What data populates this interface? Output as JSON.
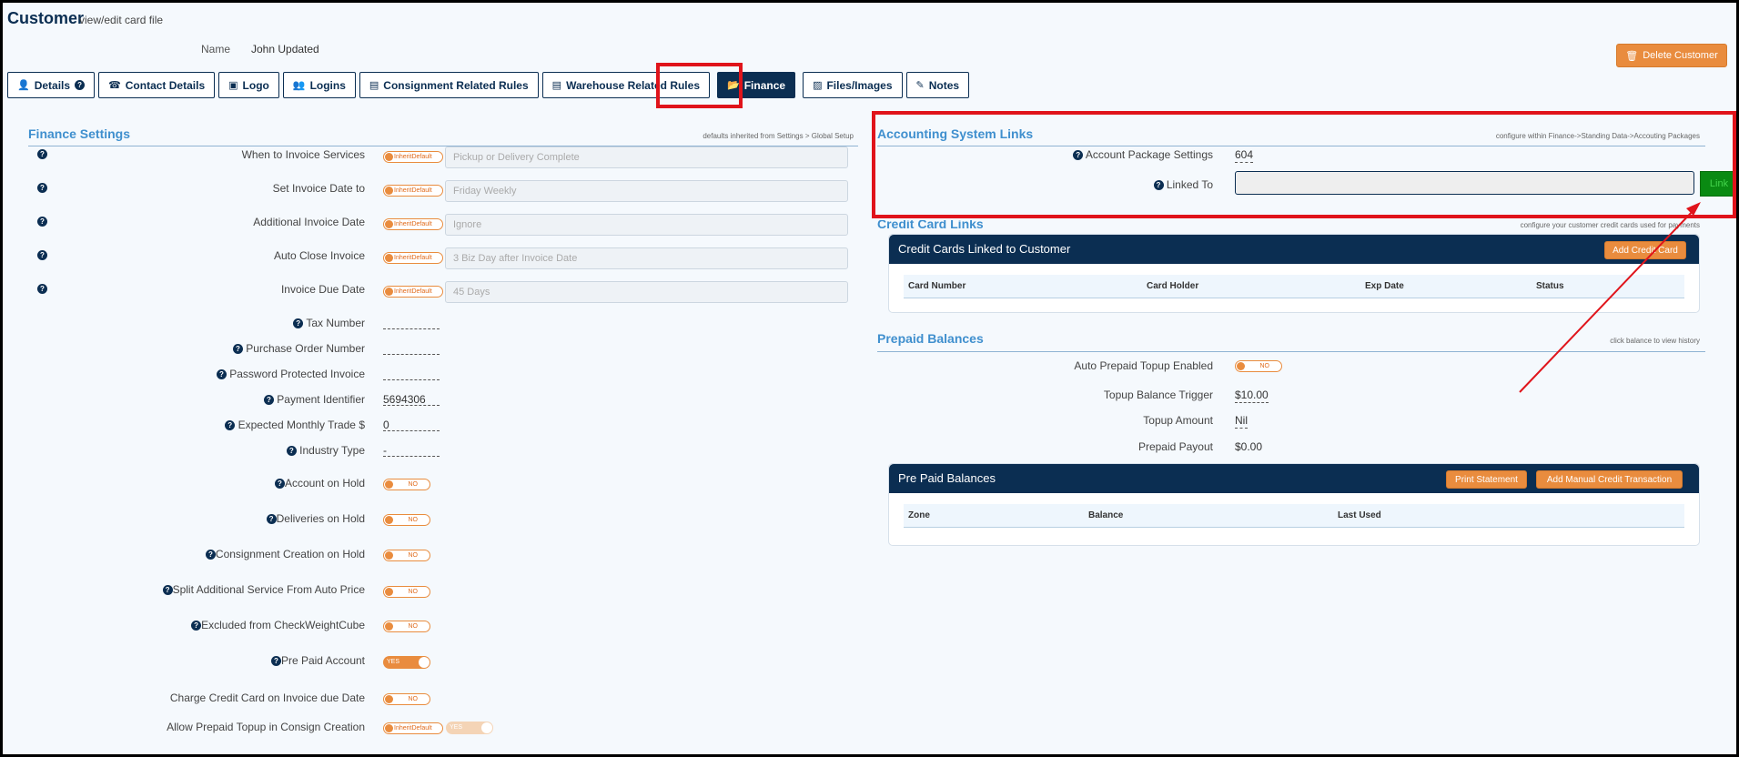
{
  "header": {
    "title": "Customer",
    "subtitle": "view/edit card file",
    "name_label": "Name",
    "name_value": "John Updated",
    "delete_button": "Delete Customer"
  },
  "tabs": [
    {
      "label": "Details",
      "icon": "user-icon"
    },
    {
      "label": "Contact Details",
      "icon": "phone-icon"
    },
    {
      "label": "Logo",
      "icon": "image-icon"
    },
    {
      "label": "Logins",
      "icon": "users-icon"
    },
    {
      "label": "Consignment Related Rules",
      "icon": "file-icon"
    },
    {
      "label": "Warehouse Related Rules",
      "icon": "file-icon"
    },
    {
      "label": "Finance",
      "icon": "folder-open-icon",
      "active": true
    },
    {
      "label": "Files/Images",
      "icon": "file-image-icon"
    },
    {
      "label": "Notes",
      "icon": "pencil-icon"
    }
  ],
  "finance_settings": {
    "title": "Finance Settings",
    "hint": "defaults inherited from Settings > Global Setup",
    "inherit_label": "InheritDefault",
    "inherited_rows": [
      {
        "label": "When to Invoice Services",
        "value": "Pickup or Delivery Complete"
      },
      {
        "label": "Set Invoice Date to",
        "value": "Friday Weekly"
      },
      {
        "label": "Additional Invoice Date",
        "value": "Ignore"
      },
      {
        "label": "Auto Close Invoice",
        "value": "3 Biz Day after Invoice Date"
      },
      {
        "label": "Invoice Due Date",
        "value": "45 Days"
      }
    ],
    "value_rows": [
      {
        "label": "Tax Number",
        "value": ""
      },
      {
        "label": "Purchase Order Number",
        "value": ""
      },
      {
        "label": "Password Protected Invoice",
        "value": ""
      },
      {
        "label": "Payment Identifier",
        "value": "5694306"
      },
      {
        "label": "Expected Monthly Trade $",
        "value": "0"
      },
      {
        "label": "Industry Type",
        "value": "-"
      }
    ],
    "toggle_rows": [
      {
        "label": "Account on Hold",
        "state": "NO"
      },
      {
        "label": "Deliveries on Hold",
        "state": "NO"
      },
      {
        "label": "Consignment Creation on Hold",
        "state": "NO"
      },
      {
        "label": "Split Additional Service From Auto Price",
        "state": "NO"
      },
      {
        "label": "Excluded from CheckWeightCube",
        "state": "NO"
      },
      {
        "label": "Pre Paid Account",
        "state": "YES"
      },
      {
        "label": "Charge Credit Card on Invoice due Date",
        "state": "NO"
      },
      {
        "label": "Allow Prepaid Topup in Consign Creation",
        "state": "YES"
      }
    ]
  },
  "accounting": {
    "title": "Accounting System Links",
    "hint": "configure within Finance->Standing Data->Accouting Packages",
    "package_label": "Account Package Settings",
    "package_value": "604",
    "linked_label": "Linked To",
    "link_button": "Link"
  },
  "credit_cards": {
    "section_title": "Credit Card Links",
    "hint": "configure your customer credit cards used for payments",
    "card_title": "Credit Cards Linked to Customer",
    "add_button": "Add Credit Card",
    "columns": [
      "Card Number",
      "Card Holder",
      "Exp Date",
      "Status"
    ]
  },
  "prepaid": {
    "title": "Prepaid Balances",
    "hint": "click balance to view history",
    "topup_enabled_label": "Auto Prepaid Topup Enabled",
    "topup_enabled_state": "NO",
    "trigger_label": "Topup Balance Trigger",
    "trigger_value": "$10.00",
    "amount_label": "Topup Amount",
    "amount_value": "Nil",
    "payout_label": "Prepaid Payout",
    "payout_value": "$0.00",
    "card_title": "Pre Paid Balances",
    "print_button": "Print Statement",
    "add_button": "Add Manual Credit Transaction",
    "columns": [
      "Zone",
      "Balance",
      "Last Used"
    ]
  },
  "colors": {
    "navy": "#0b2e52",
    "orange": "#e98c3e",
    "heading_blue": "#3f8fce",
    "highlight_red": "#e0141b",
    "link_green": "#0a8a12"
  }
}
